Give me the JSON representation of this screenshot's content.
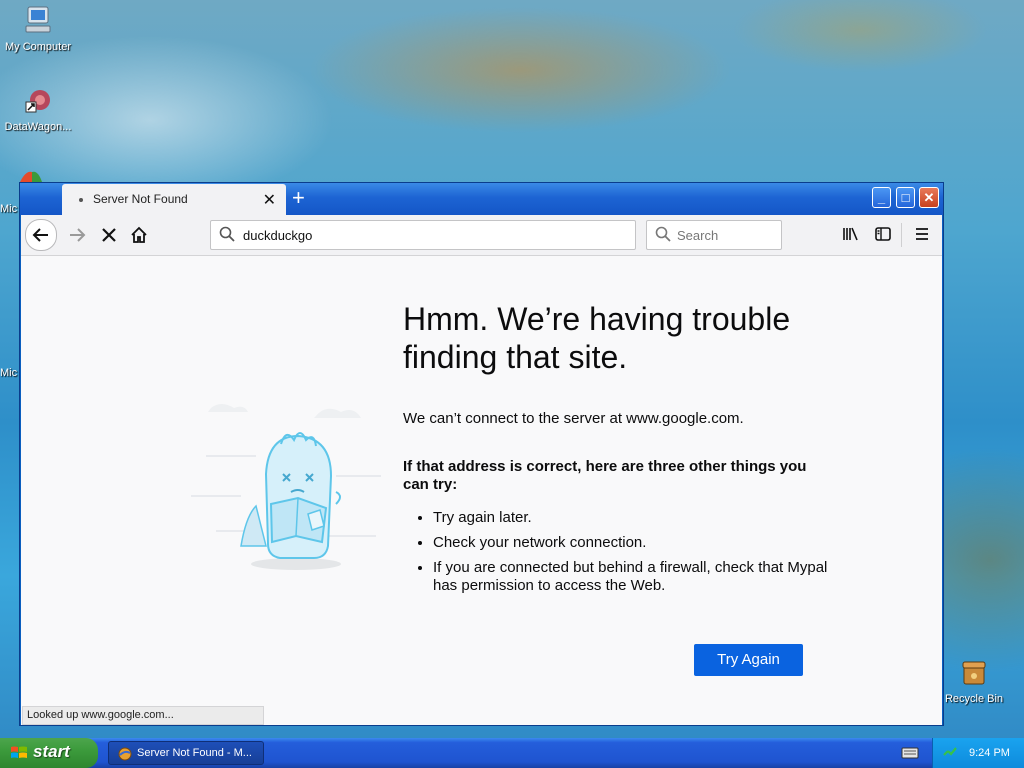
{
  "desktop": {
    "icons": [
      {
        "label": "My Computer"
      },
      {
        "label": "DataWagon..."
      },
      {
        "label": "Recycle Bin"
      }
    ],
    "partial_labels": [
      "Mic",
      "Mic"
    ]
  },
  "browser": {
    "tab_title": "Server Not Found",
    "new_tab_symbol": "+",
    "url_value": "duckduckgo",
    "search_placeholder": "Search",
    "error": {
      "title": "Hmm. We’re having trouble finding that site.",
      "description": "We can’t connect to the server at www.google.com.",
      "subtitle": "If that address is correct, here are three other things you can try:",
      "items": [
        "Try again later.",
        "Check your network connection.",
        "If you are connected but behind a firewall, check that Mypal has permission to access the Web."
      ],
      "button": "Try Again"
    },
    "status": "Looked up www.google.com..."
  },
  "taskbar": {
    "start_label": "start",
    "task_label": "Server Not Found - M...",
    "clock": "9:24 PM"
  },
  "colors": {
    "accent": "#0a63e0",
    "titlebar": "#1d64d3",
    "taskbar": "#245edb",
    "start": "#3c9b3c"
  }
}
